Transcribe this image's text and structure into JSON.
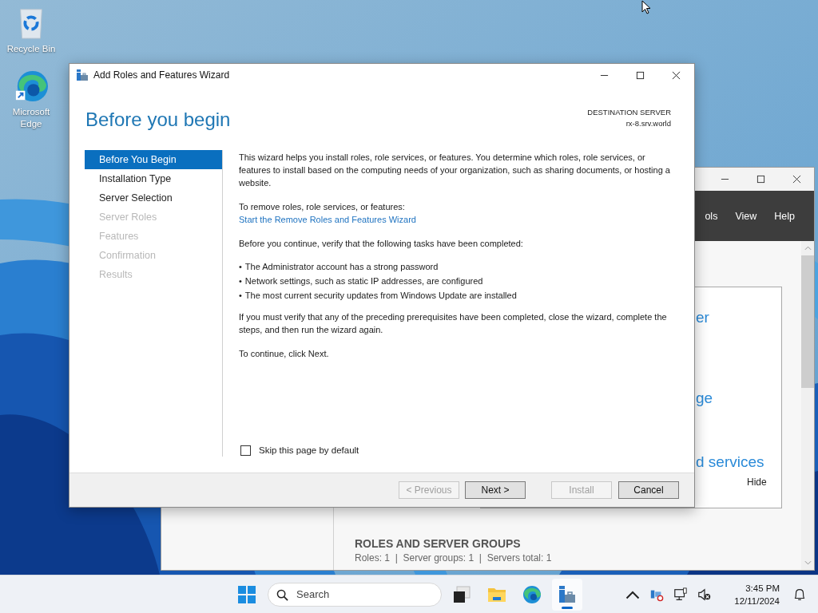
{
  "desktop_icons": [
    {
      "kind": "recycle-bin",
      "label": "Recycle Bin"
    },
    {
      "kind": "edge",
      "label": "Microsoft Edge"
    }
  ],
  "server_manager": {
    "menu": [
      "ols",
      "View",
      "Help"
    ],
    "tiles": [
      "er",
      "ge",
      "d services"
    ],
    "hide_link": "Hide",
    "section_title": "ROLES AND SERVER GROUPS",
    "summary": "Roles: 1  |  Server groups: 1  |  Servers total: 1"
  },
  "wizard": {
    "title": "Add Roles and Features Wizard",
    "heading": "Before you begin",
    "destination_label": "DESTINATION SERVER",
    "destination_server": "rx-8.srv.world",
    "steps": [
      {
        "label": "Before You Begin",
        "selected": true,
        "disabled": false
      },
      {
        "label": "Installation Type",
        "selected": false,
        "disabled": false
      },
      {
        "label": "Server Selection",
        "selected": false,
        "disabled": false
      },
      {
        "label": "Server Roles",
        "selected": false,
        "disabled": true
      },
      {
        "label": "Features",
        "selected": false,
        "disabled": true
      },
      {
        "label": "Confirmation",
        "selected": false,
        "disabled": true
      },
      {
        "label": "Results",
        "selected": false,
        "disabled": true
      }
    ],
    "intro": "This wizard helps you install roles, role services, or features. You determine which roles, role services, or features to install based on the computing needs of your organization, such as sharing documents, or hosting a website.",
    "remove_label": "To remove roles, role services, or features:",
    "remove_link": "Start the Remove Roles and Features Wizard",
    "verify_text": "Before you continue, verify that the following tasks have been completed:",
    "tasks": [
      {
        "mark": "•",
        "text": "The Administrator account has a strong password"
      },
      {
        "mark": "•",
        "text": "Network settings, such as static IP addresses, are configured"
      },
      {
        "mark": "•",
        "text": "The most current security updates from Windows Update are installed"
      }
    ],
    "prereq_text": "If you must verify that any of the preceding prerequisites have been completed, close the wizard, complete the steps, and then run the wizard again.",
    "continue_text": "To continue, click Next.",
    "skip_checkbox": {
      "label": "Skip this page by default",
      "checked": false
    },
    "buttons": [
      {
        "label": "< Previous",
        "disabled": true
      },
      {
        "label": "Next >",
        "disabled": false
      },
      {
        "label": "Install",
        "disabled": true
      },
      {
        "label": "Cancel",
        "disabled": false
      }
    ]
  },
  "taskbar": {
    "search_placeholder": "Search",
    "apps": [
      {
        "kind": "task-view",
        "active": false
      },
      {
        "kind": "file-explorer",
        "active": false
      },
      {
        "kind": "edge",
        "active": false
      },
      {
        "kind": "server-manager",
        "active": true
      }
    ],
    "time": "3:45 PM",
    "date": "12/11/2024"
  }
}
